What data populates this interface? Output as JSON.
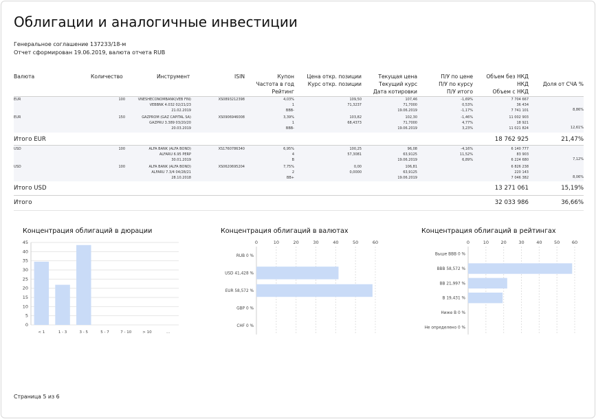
{
  "title": "Облигации и аналогичные инвестиции",
  "agreement": "Генеральное соглашение 137233/18-м",
  "report_info": "Отчет сформирован 19.06.2019, валюта отчета RUB",
  "table": {
    "headers": {
      "currency": "Валюта",
      "quantity": "Количество",
      "instrument": "Инструмент",
      "isin": "ISIN",
      "coupon": [
        "Купон",
        "Частота в год",
        "Рейтинг"
      ],
      "open_price": [
        "Цена откр. позиции",
        "Курс откр. позиции"
      ],
      "current_price": [
        "Текущая цена",
        "Текущий курс",
        "Дата котировки"
      ],
      "pnl": [
        "П/У по цене",
        "П/У по курсу",
        "П/У итого"
      ],
      "volume": [
        "Объем без НКД",
        "НКД",
        "Объем с НКД"
      ],
      "share": "Доля от СЧА %"
    },
    "groups": [
      {
        "rows": [
          {
            "currency": "EUR",
            "quantity": "100",
            "instrument": [
              "VNESHECONOMBANK(VEB FIN)",
              "VEBBNK 4.032 02/21/23",
              "21.02.2019"
            ],
            "isin": "XS0893212398",
            "coupon": [
              "4,03%",
              "1",
              "BBB-"
            ],
            "open": [
              "109,50",
              "71,3237",
              ""
            ],
            "current": [
              "107,46",
              "71,7000",
              "19.06.2019"
            ],
            "pnl": [
              "-1,69%",
              "0,53%",
              "-1,17%"
            ],
            "volume": [
              "7 704 667",
              "36 434",
              "7 741 101"
            ],
            "share": "8,86%"
          },
          {
            "currency": "EUR",
            "quantity": "150",
            "instrument": [
              "GAZPROM (GAZ CAPITAL SA)",
              "GAZPRU 3.389 03/20/20",
              "20.03.2019"
            ],
            "isin": "XS0906946008",
            "coupon": [
              "3,39%",
              "1",
              "BBB-"
            ],
            "open": [
              "103,82",
              "68,4373",
              ""
            ],
            "current": [
              "102,30",
              "71,7000",
              "19.06.2019"
            ],
            "pnl": [
              "-1,46%",
              "4,77%",
              "3,23%"
            ],
            "volume": [
              "11 002 903",
              "18 921",
              "11 021 824"
            ],
            "share": "12,61%"
          }
        ],
        "total_label": "Итого EUR",
        "total_volume": "18 762 925",
        "total_share": "21,47%"
      },
      {
        "rows": [
          {
            "currency": "USD",
            "quantity": "100",
            "instrument": [
              "ALFA BANK (ALFA BOND)",
              "ALFARU 6.95 PERP",
              "30.01.2019"
            ],
            "isin": "XS1760786340",
            "coupon": [
              "6,95%",
              "4",
              "B"
            ],
            "open": [
              "100,25",
              "57,3081",
              ""
            ],
            "current": [
              "96,08",
              "63,9125",
              "19.06.2019"
            ],
            "pnl": [
              "-4,16%",
              "11,52%",
              "6,89%"
            ],
            "volume": [
              "6 140 777",
              "83 903",
              "6 224 680"
            ],
            "share": "7,12%"
          },
          {
            "currency": "USD",
            "quantity": "100",
            "instrument": [
              "ALFA BANK (ALFA BOND)",
              "ALFARU 7.3/4 04/28/21",
              "28.10.2018"
            ],
            "isin": "XS0620695204",
            "coupon": [
              "7,75%",
              "2",
              "BB+"
            ],
            "open": [
              "0,00",
              "0,0000",
              ""
            ],
            "current": [
              "106,81",
              "63,9125",
              "19.06.2019"
            ],
            "pnl": [
              "",
              "",
              ""
            ],
            "volume": [
              "6 826 238",
              "220 143",
              "7 046 382"
            ],
            "share": "8,06%"
          }
        ],
        "total_label": "Итого USD",
        "total_volume": "13 271 061",
        "total_share": "15,19%"
      }
    ],
    "grand_total_label": "Итого",
    "grand_total_volume": "32 033 986",
    "grand_total_share": "36,66%"
  },
  "chart_data": [
    {
      "type": "bar",
      "title": "Концентрация облигаций в дюрации",
      "categories": [
        "< 1",
        "1 - 3",
        "3 - 5",
        "5 - 7",
        "7 - 10",
        "> 10",
        "..."
      ],
      "values": [
        34.5,
        21.9,
        43.6,
        0,
        0,
        0,
        0
      ],
      "ylim": [
        0,
        45
      ],
      "yticks": [
        "0",
        "5",
        "10",
        "15",
        "20",
        "25",
        "30",
        "35",
        "40",
        "45"
      ],
      "grid": true,
      "color": "#c9dbf7"
    },
    {
      "type": "bar",
      "orientation": "horizontal",
      "title": "Концентрация облигаций в валютах",
      "categories": [
        "RUB 0 %",
        "USD 41,428 %",
        "EUR 58,572 %",
        "GBP 0 %",
        "CHF 0 %"
      ],
      "values": [
        0,
        41.428,
        58.572,
        0,
        0
      ],
      "xlim": [
        0,
        60
      ],
      "xticks": [
        "0",
        "10",
        "20",
        "30",
        "40",
        "50",
        "60"
      ],
      "grid": true,
      "color": "#c9dbf7"
    },
    {
      "type": "bar",
      "orientation": "horizontal",
      "title": "Концентрация облигаций в рейтингах",
      "categories": [
        "Выше BBB 0 %",
        "BBB 58,572 %",
        "BB 21,997 %",
        "B 19,431 %",
        "Ниже B 0 %",
        "Не определено 0 %"
      ],
      "values": [
        0,
        58.572,
        21.997,
        19.431,
        0,
        0
      ],
      "xlim": [
        0,
        60
      ],
      "xticks": [
        "0",
        "10",
        "20",
        "30",
        "40",
        "50",
        "60"
      ],
      "grid": true,
      "color": "#c9dbf7"
    }
  ],
  "footer": "Страница 5 из 6"
}
